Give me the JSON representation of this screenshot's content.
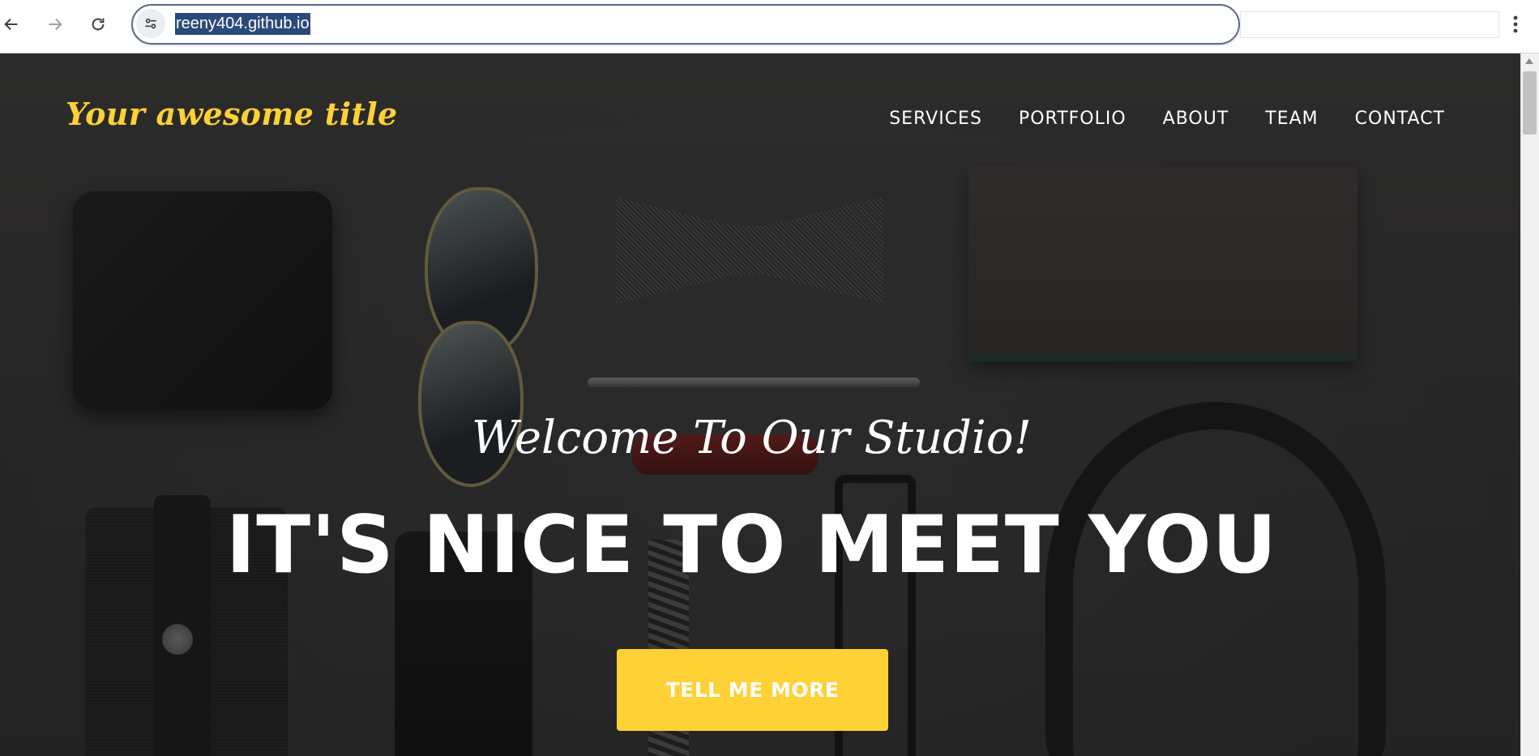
{
  "browser": {
    "url": "reeny404.github.io",
    "back_icon": "arrow-left-icon",
    "forward_icon": "arrow-right-icon",
    "reload_icon": "reload-icon",
    "site_info_icon": "tune-icon",
    "menu_icon": "more-vertical-icon"
  },
  "header": {
    "brand": "Your awesome title",
    "nav": [
      "SERVICES",
      "PORTFOLIO",
      "ABOUT",
      "TEAM",
      "CONTACT"
    ]
  },
  "hero": {
    "subheading": "Welcome To Our Studio!",
    "heading": "IT'S NICE TO MEET YOU",
    "button": "TELL ME MORE"
  },
  "colors": {
    "accent": "#fed136",
    "text": "#ffffff",
    "url_highlight": "#2b4a7a"
  }
}
